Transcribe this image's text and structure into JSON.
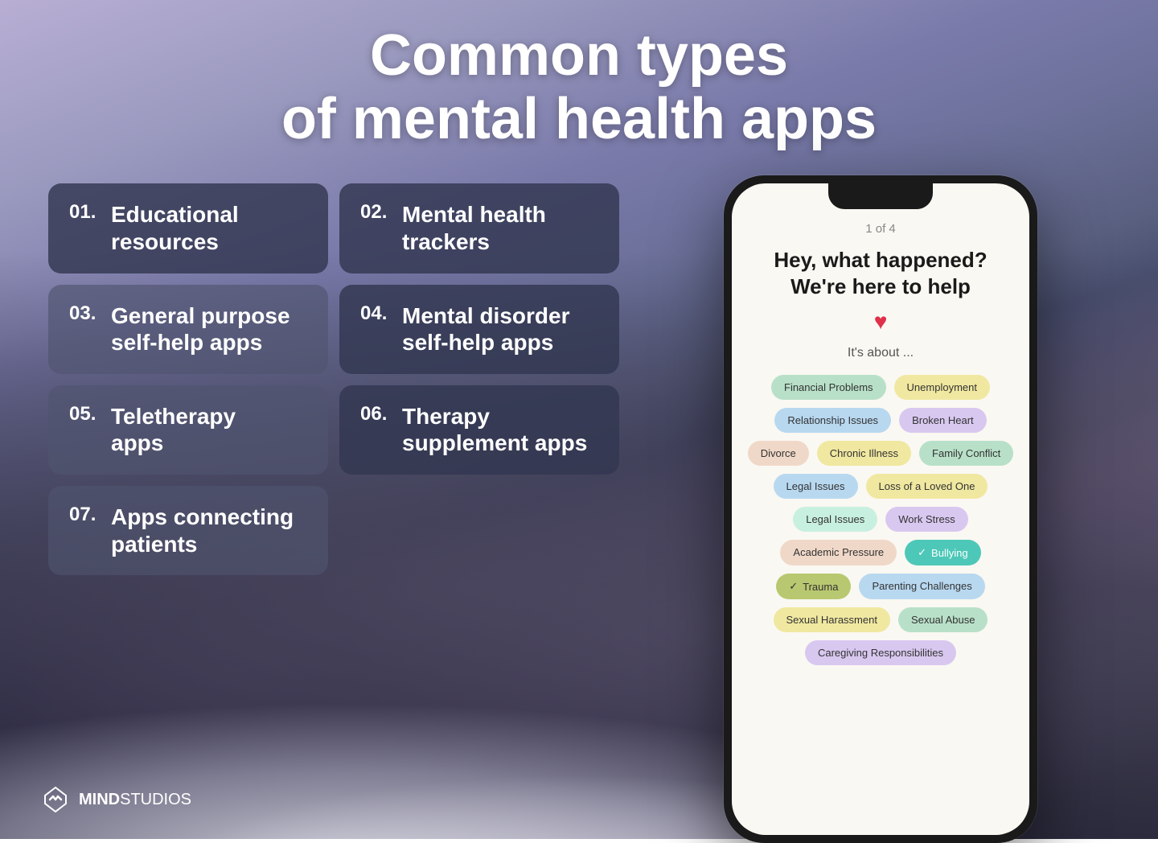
{
  "title": {
    "line1": "Common types",
    "line2": "of mental health apps"
  },
  "cards": [
    {
      "id": "01",
      "label": "Educational\nresources",
      "style": "dark"
    },
    {
      "id": "02",
      "label": "Mental health\ntrackers",
      "style": "dark"
    },
    {
      "id": "03",
      "label": "General purpose\nself-help apps",
      "style": "light"
    },
    {
      "id": "04",
      "label": "Mental disorder\nself-help apps",
      "style": "dark"
    },
    {
      "id": "05",
      "label": "Teletherapy\napps",
      "style": "light"
    },
    {
      "id": "06",
      "label": "Therapy\nsupplement apps",
      "style": "dark"
    },
    {
      "id": "07",
      "label": "Apps connecting\npatients",
      "style": "light"
    }
  ],
  "phone": {
    "pagination": "1 of 4",
    "heading": "Hey, what happened?\nWe're here to help",
    "subtitle": "It's about ...",
    "tags": [
      {
        "text": "Financial Problems",
        "style": "green"
      },
      {
        "text": "Unemployment",
        "style": "yellow"
      },
      {
        "text": "Relationship Issues",
        "style": "blue"
      },
      {
        "text": "Broken Heart",
        "style": "lavender"
      },
      {
        "text": "Divorce",
        "style": "peach"
      },
      {
        "text": "Chronic Illness",
        "style": "yellow"
      },
      {
        "text": "Family Conflict",
        "style": "green"
      },
      {
        "text": "Legal Issues",
        "style": "blue"
      },
      {
        "text": "Loss of a Loved One",
        "style": "yellow"
      },
      {
        "text": "Legal Issues",
        "style": "mint"
      },
      {
        "text": "Work Stress",
        "style": "lavender"
      },
      {
        "text": "Academic Pressure",
        "style": "peach"
      },
      {
        "text": "Bullying",
        "style": "selected"
      },
      {
        "text": "Trauma",
        "style": "selected-olive"
      },
      {
        "text": "Parenting Challenges",
        "style": "blue"
      },
      {
        "text": "Sexual Harassment",
        "style": "yellow"
      },
      {
        "text": "Sexual Abuse",
        "style": "green"
      },
      {
        "text": "Caregiving Responsibilities",
        "style": "lavender"
      }
    ]
  },
  "logo": {
    "text_bold": "MIND",
    "text_light": "STUDIOS"
  }
}
